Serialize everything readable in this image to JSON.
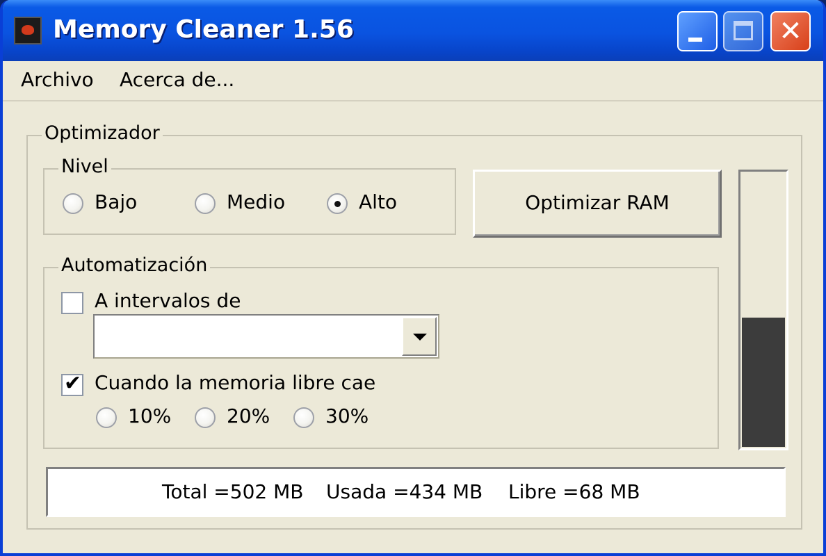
{
  "window": {
    "title": "Memory Cleaner 1.56",
    "title_bar_color": "#0a53e0"
  },
  "menu": {
    "items": [
      "Archivo",
      "Acerca de..."
    ]
  },
  "optimizer": {
    "label": "Optimizador",
    "nivel": {
      "label": "Nivel",
      "options": [
        "Bajo",
        "Medio",
        "Alto"
      ],
      "selected": "Alto"
    },
    "optimize_button": "Optimizar RAM",
    "automation": {
      "label": "Automatización",
      "interval_checkbox": {
        "label": "A intervalos de",
        "checked": false
      },
      "interval_select_value": "",
      "freemem_checkbox": {
        "label": "Cuando la memoria libre cae",
        "checked": true
      },
      "thresholds": [
        "10%",
        "20%",
        "30%"
      ]
    },
    "memory_meter": {
      "used_fraction": 0.468,
      "fill_color": "#3c3c3c"
    }
  },
  "status": {
    "total": "Total =502 MB",
    "used": "Usada =434 MB",
    "free": "Libre =68 MB"
  }
}
